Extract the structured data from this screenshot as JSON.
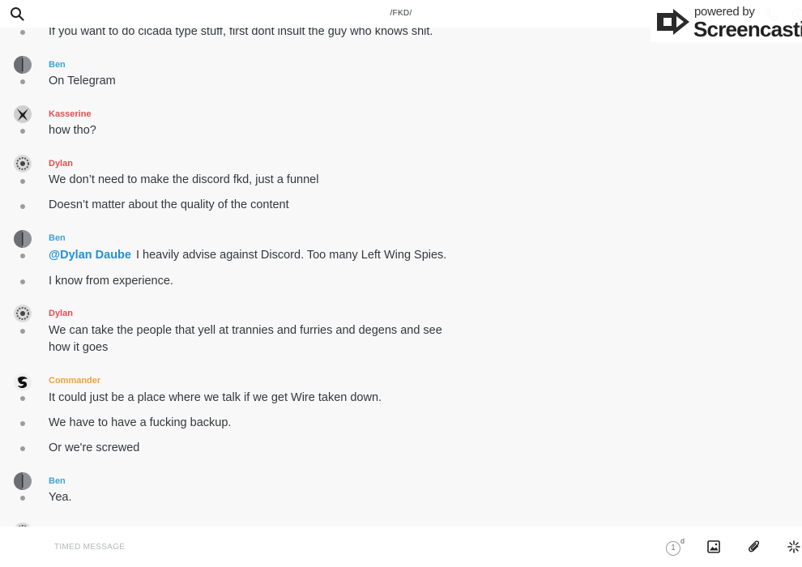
{
  "header": {
    "title": "/FKD/",
    "search_icon": "search-icon",
    "call_icon": "phone-icon",
    "info_icon": "info-icon"
  },
  "watermark": {
    "powered_by": "powered by",
    "brand": "Screencastify"
  },
  "colors": {
    "ben": "#3fa3d8",
    "kasserine": "#e2504e",
    "dylan": "#e2504e",
    "commander": "#f2a13b",
    "mention": "#2391d3"
  },
  "messages": [
    {
      "text": "If you want to do cicada type stuff, first dont insult the guy who knows shit."
    },
    {
      "sender": "Ben",
      "text": "On Telegram"
    },
    {
      "sender": "Kasserine",
      "text": "how tho?"
    },
    {
      "sender": "Dylan",
      "text": "We don’t need to make the discord fkd, just a funnel"
    },
    {
      "text": "Doesn’t matter about the quality of the content"
    },
    {
      "sender": "Ben",
      "mention": "@Dylan Daube",
      "text": "I heavily advise against Discord. Too many Left Wing Spies."
    },
    {
      "text": "I know from experience."
    },
    {
      "sender": "Dylan",
      "text": "We can take the people that yell at trannies and furries and degens and see how it goes"
    },
    {
      "sender": "Commander",
      "text": "It could just be a place where we talk if we get Wire taken down."
    },
    {
      "text": "We have to have a fucking backup."
    },
    {
      "text": "Or we're screwed"
    },
    {
      "sender": "Ben",
      "text": "Yea."
    }
  ],
  "footer": {
    "placeholder": "TIMED MESSAGE",
    "timer_value": "1",
    "timer_unit": "d",
    "image_icon": "image-icon",
    "attach_icon": "paperclip-icon",
    "ping_icon": "ping-icon"
  }
}
